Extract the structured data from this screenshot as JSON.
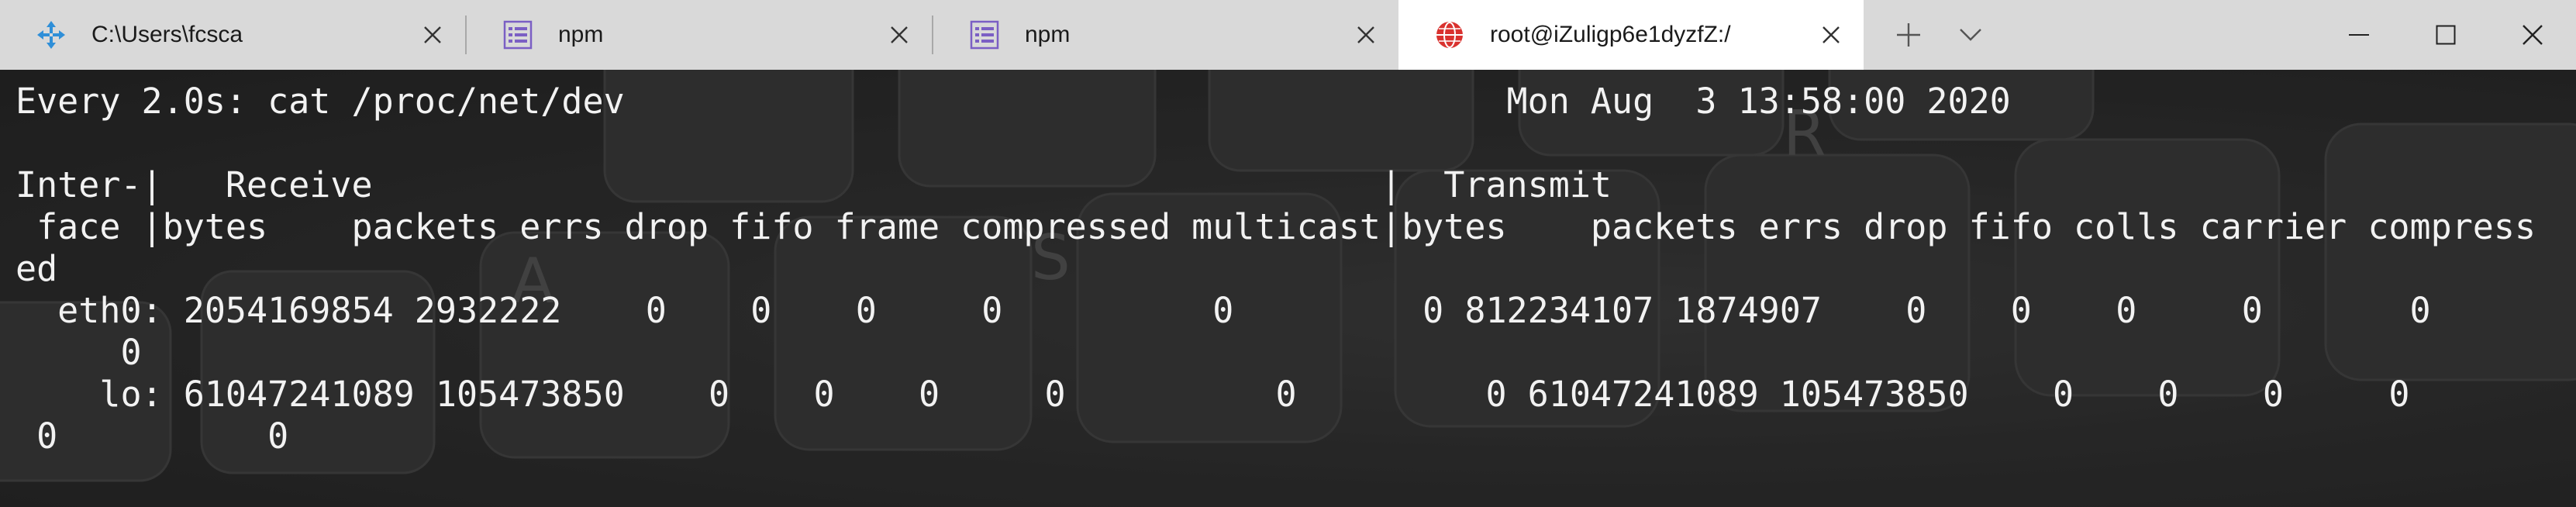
{
  "tabs": [
    {
      "title": "C:\\Users\\fcsca",
      "icon": "move-arrows-icon",
      "active": false
    },
    {
      "title": "npm",
      "icon": "list-icon",
      "active": false
    },
    {
      "title": "npm",
      "icon": "list-icon",
      "active": false
    },
    {
      "title": "root@iZuligp6e1dyzfZ:/",
      "icon": "globe-icon",
      "active": true
    }
  ],
  "colors": {
    "tabbar_bg": "#d9d9d9",
    "active_tab_bg": "#ffffff",
    "terminal_text": "#f2f2f2",
    "npm_icon": "#7b5fc4",
    "globe_icon": "#d9322f",
    "move_icon": "#2f8fd8"
  },
  "terminal": {
    "lines": [
      "Every 2.0s: cat /proc/net/dev                                          Mon Aug  3 13:58:00 2020",
      "",
      "Inter-|   Receive                                                |  Transmit",
      " face |bytes    packets errs drop fifo frame compressed multicast|bytes    packets errs drop fifo colls carrier compress",
      "ed",
      "  eth0: 2054169854 2932222    0    0    0     0          0         0 812234107 1874907    0    0    0     0       0",
      "     0",
      "    lo: 61047241089 105473850    0    0    0     0          0         0 61047241089 105473850    0    0    0     0",
      " 0          0"
    ]
  }
}
